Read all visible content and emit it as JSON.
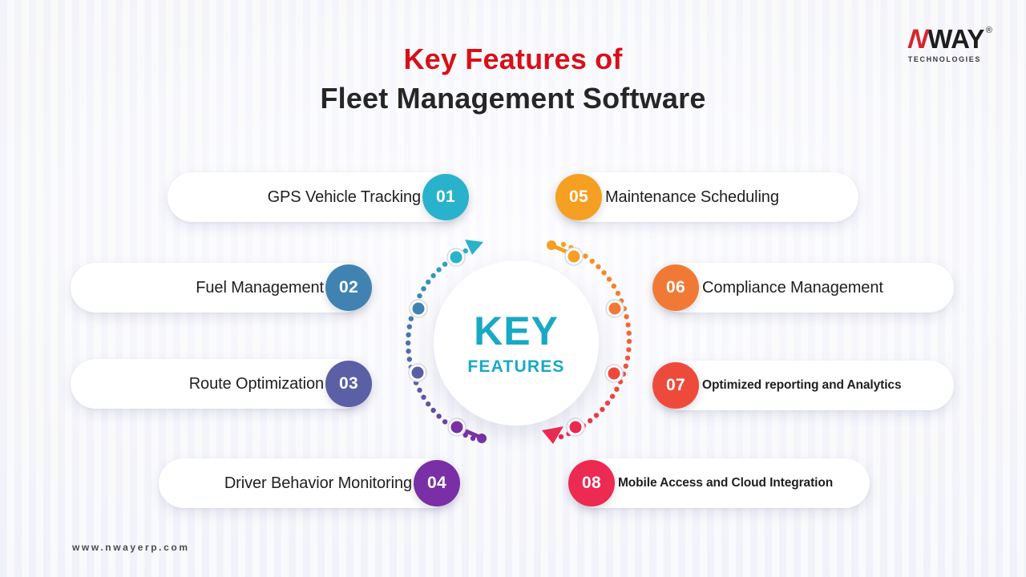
{
  "header": {
    "title_line1": "Key Features of",
    "title_line2": "Fleet Management Software",
    "title_color_1": "#d81018",
    "title_color_2": "#262626"
  },
  "logo": {
    "mark": "N",
    "name": "WAY",
    "registered": "®",
    "tagline": "TECHNOLOGIES",
    "mark_color": "#d7262b",
    "name_color": "#1d1d1d"
  },
  "center": {
    "line1": "KEY",
    "line2": "FEATURES",
    "color": "#18a9c4"
  },
  "features": [
    {
      "number": "01",
      "label": "GPS Vehicle Tracking",
      "color": "#29b2cb",
      "side": "left"
    },
    {
      "number": "02",
      "label": "Fuel Management",
      "color": "#4083b2",
      "side": "left"
    },
    {
      "number": "03",
      "label": "Route Optimization",
      "color": "#5a5fa6",
      "side": "left"
    },
    {
      "number": "04",
      "label": "Driver Behavior Monitoring",
      "color": "#7a2fa6",
      "side": "left"
    },
    {
      "number": "05",
      "label": "Maintenance Scheduling",
      "color": "#f59f23",
      "side": "right"
    },
    {
      "number": "06",
      "label": "Compliance Management",
      "color": "#f07a35",
      "side": "right"
    },
    {
      "number": "07",
      "label": "Optimized reporting and Analytics",
      "color": "#ee4a3c",
      "side": "right"
    },
    {
      "number": "08",
      "label": "Mobile Access and Cloud Integration",
      "color": "#ec2a52",
      "side": "right"
    }
  ],
  "footer": {
    "url": "www.nwayerp.com"
  },
  "arc_nodes": {
    "left": [
      "#29b2cb",
      "#4083b2",
      "#5a5fa6",
      "#7a2fa6"
    ],
    "right": [
      "#f59f23",
      "#f07a35",
      "#ee4a3c",
      "#ec2a52"
    ],
    "left_arrow_color": "#29b2cb",
    "right_arrow_color": "#ec2a52"
  }
}
